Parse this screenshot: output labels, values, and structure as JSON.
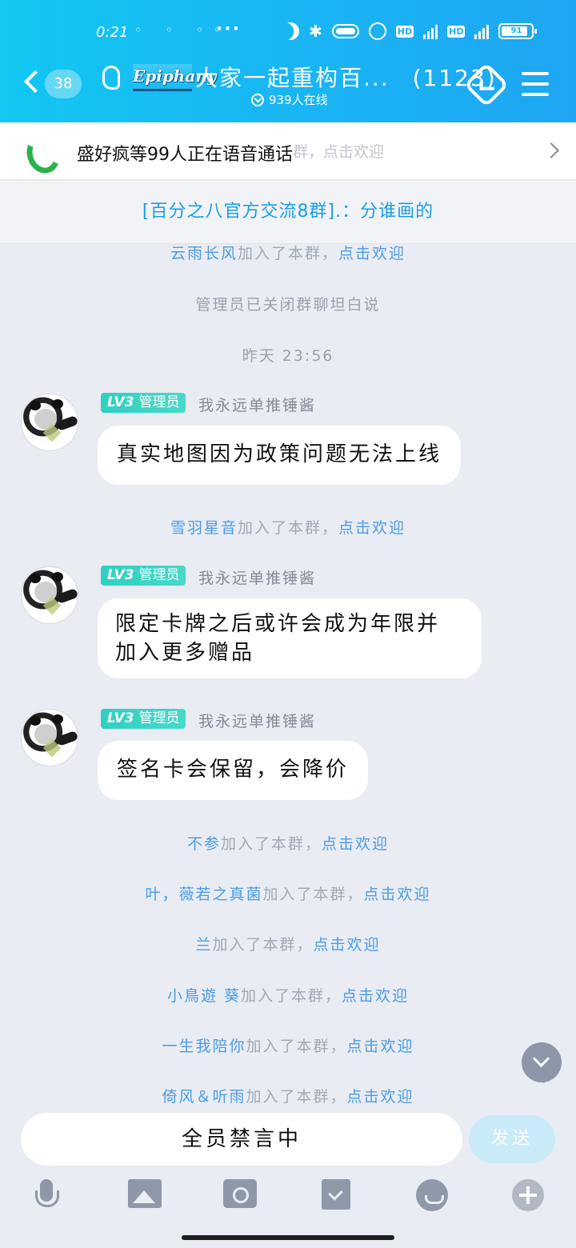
{
  "status_bar": {
    "time": "0:21",
    "dots": "◦ ◦ ◦◦",
    "more": "···",
    "hd1": "HD",
    "hd2": "HD",
    "net1": "4G",
    "net2": "4G",
    "battery": "91"
  },
  "header": {
    "back_count": "38",
    "brand_logo_text": "Epiphany",
    "title": "大家一起重构百...",
    "member_count": "(1123)",
    "online": "939人在线"
  },
  "call_bar": {
    "text": "盛好疯等99人正在语音通话",
    "ghost": "群，点击欢迎"
  },
  "pinned": {
    "text": "[百分之八官方交流8群].：分谁画的"
  },
  "messages": {
    "sys1": {
      "name": "云雨长风",
      "action": "加入了本群，",
      "link": "点击欢迎"
    },
    "sys2": {
      "text": "管理员已关闭群聊坦白说"
    },
    "timestamp": "昨天 23:56",
    "m1": {
      "level": "LV3",
      "role": "管理员",
      "sender": "我永远单推锤酱",
      "text": "真实地图因为政策问题无法上线"
    },
    "sys3": {
      "name": "雪羽星音",
      "action": "加入了本群，",
      "link": "点击欢迎"
    },
    "m2": {
      "level": "LV3",
      "role": "管理员",
      "sender": "我永远单推锤酱",
      "text_line1": "限定卡牌之后或许会成为年限并",
      "text_line2": "加入更多赠品"
    },
    "m3": {
      "level": "LV3",
      "role": "管理员",
      "sender": "我永远单推锤酱",
      "text": "签名卡会保留，会降价"
    },
    "sys4": {
      "name": "不参",
      "action": "加入了本群，",
      "link": "点击欢迎"
    },
    "sys5": {
      "name": "叶，薇若之真菌",
      "action": "加入了本群，",
      "link": "点击欢迎"
    },
    "sys6": {
      "name": "兰",
      "action": "加入了本群，",
      "link": "点击欢迎"
    },
    "sys7": {
      "name": "小鳥遊 葵",
      "action": "加入了本群，",
      "link": "点击欢迎"
    },
    "sys8": {
      "name": "一生我陪你",
      "action": "加入了本群，",
      "link": "点击欢迎"
    },
    "sys9": {
      "name": "倚风＆听雨",
      "action": "加入了本群，",
      "link": "点击欢迎"
    }
  },
  "input": {
    "text": "全员禁言中",
    "send": "发送"
  },
  "toolbar": {
    "icons": [
      "microphone-icon",
      "image-icon",
      "camera-icon",
      "red-packet-icon",
      "emoji-icon",
      "plus-icon"
    ]
  },
  "colors": {
    "header_gradient_start": "#12c7f2",
    "header_gradient_end": "#1ea6f2",
    "link": "#4b9ce6",
    "badge": "#2fd0c0",
    "chat_bg": "#e9ecf3",
    "call_green": "#2bb24c"
  }
}
